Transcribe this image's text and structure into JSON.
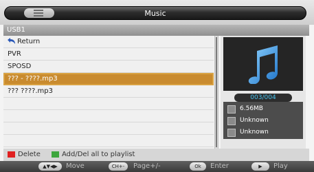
{
  "header": {
    "title": "Music",
    "menu_icon": "list-icon"
  },
  "source": {
    "label": "USB1"
  },
  "file_list": {
    "items": [
      {
        "label": "Return",
        "icon": "return-arrow-icon"
      },
      {
        "label": "PVR"
      },
      {
        "label": "SPOSD"
      },
      {
        "label": "??? - ????.mp3",
        "selected": true
      },
      {
        "label": "??? ????.mp3"
      }
    ]
  },
  "info_panel": {
    "art_icon": "music-note-icon",
    "counter": "003/004",
    "size": "6.56MB",
    "artist": "Unknown",
    "album": "Unknown"
  },
  "playlist_hint": {
    "delete_label": "Delete",
    "add_label": "Add/Del all to playlist",
    "delete_color": "#e02020",
    "add_color": "#3ea63e"
  },
  "footer": {
    "move_key": "▲▼◀▶",
    "move_label": "Move",
    "page_key": "CH+-",
    "page_label": "Page+/-",
    "enter_key": "Ok",
    "enter_label": "Enter",
    "play_key": "▶",
    "play_label": "Play"
  }
}
